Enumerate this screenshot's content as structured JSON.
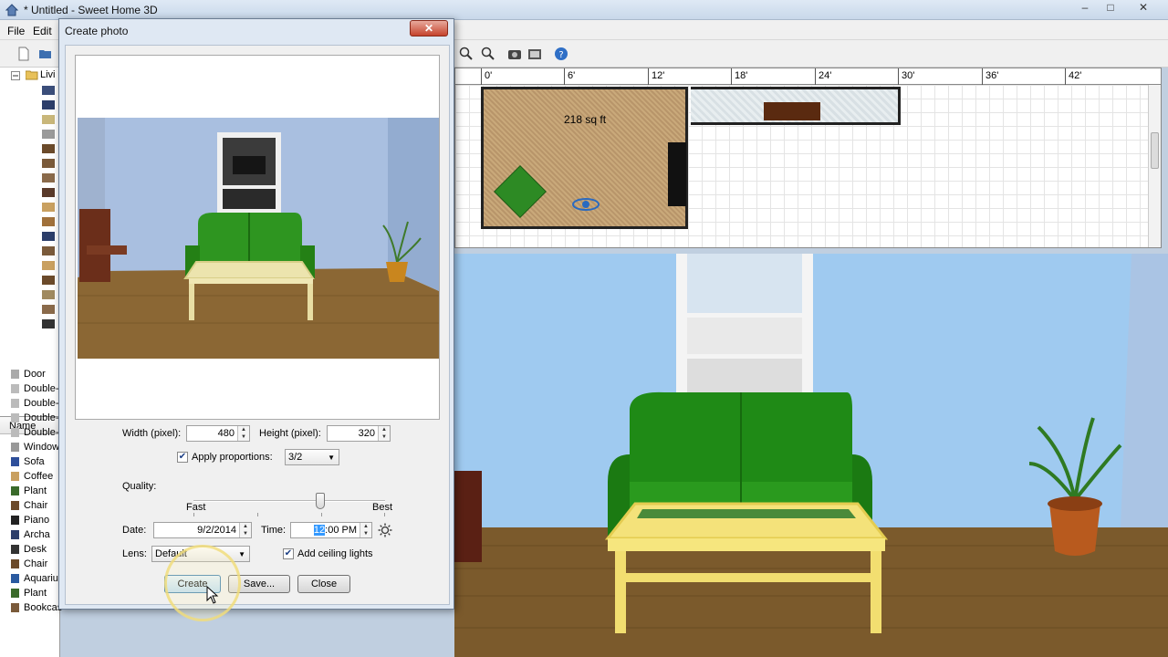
{
  "app": {
    "title": "* Untitled - Sweet Home 3D"
  },
  "menu": {
    "items": [
      "File",
      "Edit"
    ]
  },
  "window_controls": {
    "minimize": "–",
    "maximize": "□",
    "close": "✕"
  },
  "tree": {
    "root_label": "Livi"
  },
  "furniture": {
    "header": "Name",
    "rows": [
      "Door",
      "Double-",
      "Double-",
      "Double-",
      "Double-",
      "Window",
      "Sofa",
      "Coffee",
      "Plant",
      "Chair",
      "Piano",
      "Archa",
      "Desk",
      "Chair",
      "Aquariu",
      "Plant",
      "Bookcas"
    ]
  },
  "plan": {
    "ruler_labels": [
      "0'",
      "6'",
      "12'",
      "18'",
      "24'",
      "30'",
      "36'",
      "42'"
    ],
    "room_area": "218 sq ft"
  },
  "dialog": {
    "title": "Create photo",
    "close_label": "✕",
    "width_label": "Width (pixel):",
    "width_value": "480",
    "height_label": "Height (pixel):",
    "height_value": "320",
    "apply_proportions_label": "Apply proportions:",
    "apply_proportions_checked": true,
    "proportion_value": "3/2",
    "quality_label": "Quality:",
    "quality_fast": "Fast",
    "quality_best": "Best",
    "quality_level": 0.68,
    "date_label": "Date:",
    "date_value": "9/2/2014",
    "time_label": "Time:",
    "time_value_selected": "12",
    "time_value_rest": ":00 PM",
    "lens_label": "Lens:",
    "lens_value": "Default",
    "ceiling_lights_label": "Add ceiling lights",
    "ceiling_lights_checked": true,
    "buttons": {
      "create": "Create",
      "save": "Save...",
      "close": "Close"
    }
  },
  "colors": {
    "sofa": "#2e8f1d",
    "wall": "#a7bfe2",
    "floor": "#7a5a2c",
    "table": "#f2e27a"
  }
}
